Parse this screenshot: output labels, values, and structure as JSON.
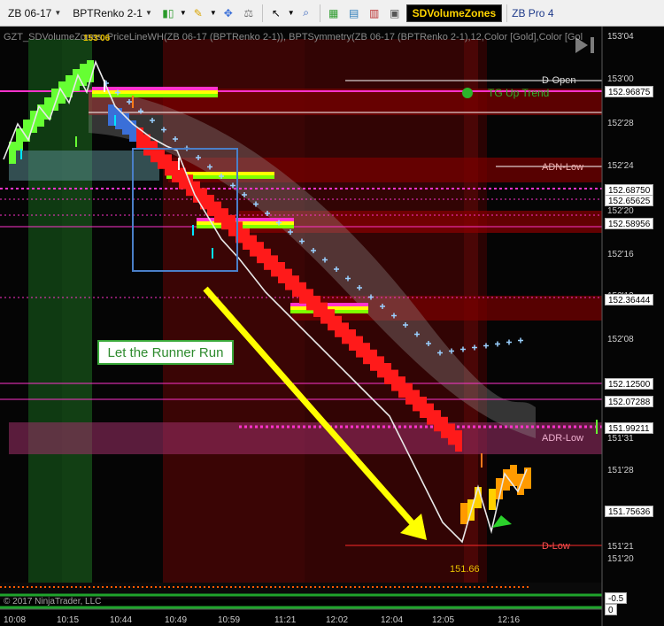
{
  "toolbar": {
    "instrument": "ZB 06-17",
    "bar_type": "BPTRenko 2-1",
    "brand_button": "SDVolumeZones",
    "workspace": "ZB Pro 4"
  },
  "chart": {
    "indicator_text": "GZT_SDVolumeZones, PriceLineWH(ZB 06-17 (BPTRenko 2-1)), BPTSymmetry(ZB 06-17 (BPTRenko 2-1),12,Color [Gold],Color [Gol",
    "callout": "Let the Runner Run",
    "trend_label": "TG Up Trend",
    "top_price": "153'06",
    "low_price": "151.66",
    "copyright": "© 2017 NinjaTrader, LLC",
    "levels": {
      "d_open": "D-Open",
      "adn_low": "ADN-Low",
      "adr_low": "ADR-Low",
      "d_low": "D-Low"
    },
    "price_axis": [
      "153'04",
      "153'00",
      "152'28",
      "152'24",
      "152'20",
      "152'16",
      "152'12",
      "152'08",
      "151'31",
      "151'28",
      "151'21",
      "151'20"
    ],
    "price_tags": [
      "152.96875",
      "152.68750",
      "152.65625",
      "152.58956",
      "152.36444",
      "152.12500",
      "152.07288",
      "151.99211",
      "151.75636",
      "-0.5",
      "0"
    ],
    "time_axis": [
      "10:08",
      "10:15",
      "10:44",
      "10:49",
      "10:59",
      "11:21",
      "12:02",
      "12:04",
      "12:05",
      "12:16"
    ]
  },
  "colors": {
    "background": "#000000",
    "up_brick": "#7fff00",
    "down_brick": "#ff1a1a",
    "neutral_brick": "#3a6fd8",
    "callout_border": "#3aa93a",
    "arrow": "#ffff00",
    "zone_red": "#8b0000",
    "zone_magenta": "#b0307a"
  },
  "icons": [
    "play-pause-icon",
    "arrow-up-icon",
    "arrow-down-icon",
    "pencil-icon",
    "cursor-icon",
    "magnifier-icon"
  ]
}
